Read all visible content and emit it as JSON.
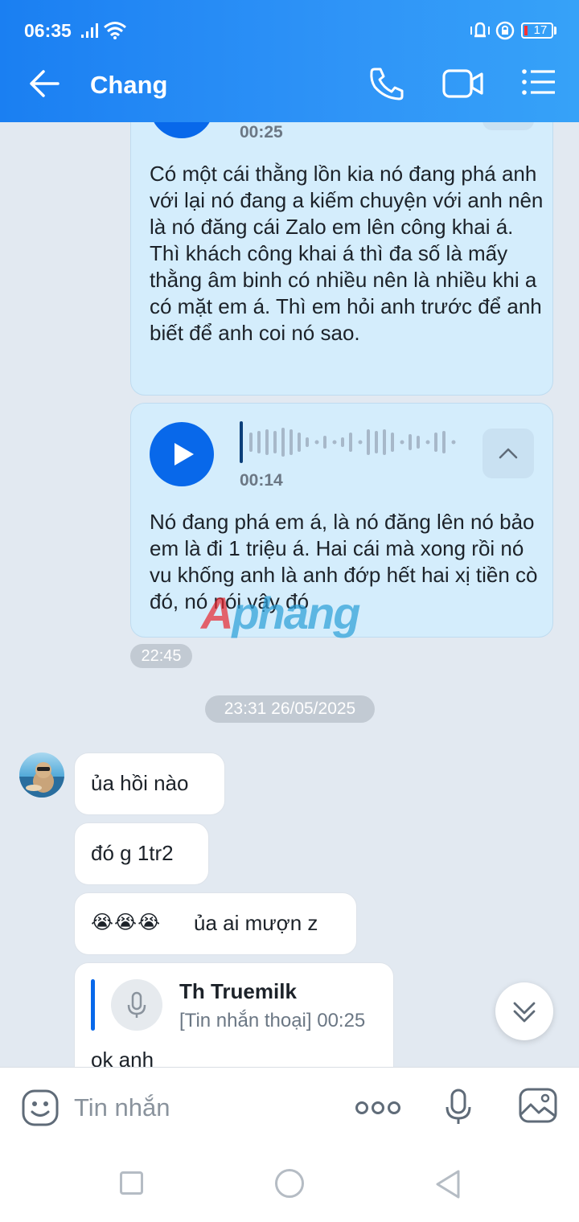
{
  "status_bar": {
    "time": "06:35",
    "battery": "17"
  },
  "header": {
    "title": "Chang"
  },
  "messages": [
    {
      "duration": "00:25",
      "transcript": "Có một cái thằng lồn kia nó đang phá anh với lại nó đang a kiếm chuyện với anh nên là nó đăng cái Zalo em lên công khai á. Thì khách công khai á thì đa số là mấy thằng âm binh có nhiều nên là nhiều khi a có mặt em á. Thì em hỏi anh trước để anh biết để anh coi nó sao."
    },
    {
      "duration": "00:14",
      "transcript": "Nó đang phá em á, là nó đăng lên nó bảo em là đi 1 triệu á. Hai cái mà xong rồi nó vu khống anh là anh đớp hết hai xị tiền cò đó, nó nói vậy đó"
    },
    {
      "time": "22:45"
    },
    {
      "date_separator": "23:31 26/05/2025"
    },
    {
      "text": "ủa hồi nào"
    },
    {
      "text": "đó g 1tr2"
    },
    {
      "emojis": "😭😭😭",
      "text": "ủa ai mượn z"
    },
    {
      "reply_name": "Th Truemilk",
      "reply_preview": "[Tin nhắn thoại] 00:25",
      "text": "ok anh"
    }
  ],
  "watermark": {
    "part_a": "A",
    "part_b": "phang"
  },
  "composer": {
    "placeholder": "Tin nhắn"
  },
  "colors": {
    "header_blue": "#1a7ff2",
    "play_blue": "#0868ea",
    "my_bubble": "#d4edfc"
  },
  "icons": [
    "back-arrow-icon",
    "phone-icon",
    "video-icon",
    "menu-icon",
    "play-icon",
    "chevron-up-icon",
    "mic-icon",
    "chevrons-down-icon",
    "emoji-icon",
    "more-dots-icon",
    "image-icon"
  ]
}
